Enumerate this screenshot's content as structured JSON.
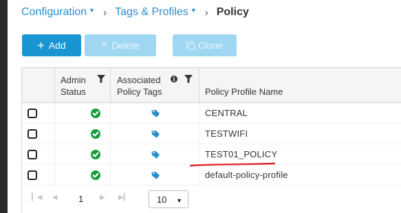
{
  "breadcrumb": {
    "items": [
      {
        "label": "Configuration"
      },
      {
        "label": "Tags & Profiles"
      }
    ],
    "current": "Policy"
  },
  "toolbar": {
    "add_label": "Add",
    "delete_label": "Delete",
    "clone_label": "Clone"
  },
  "table": {
    "columns": {
      "admin_status_line1": "Admin",
      "admin_status_line2": "Status",
      "policy_tags_line1": "Associated",
      "policy_tags_line2": "Policy Tags",
      "profile_name": "Policy Profile Name"
    },
    "rows": [
      {
        "name": "CENTRAL",
        "admin_status": "enabled"
      },
      {
        "name": "TESTWIFI",
        "admin_status": "enabled"
      },
      {
        "name": "TEST01_POLICY",
        "admin_status": "enabled"
      },
      {
        "name": "default-policy-profile",
        "admin_status": "enabled"
      }
    ]
  },
  "pager": {
    "current_page": "1",
    "per_page": "10"
  },
  "colors": {
    "primary": "#1a95d4",
    "disabled": "#9fd6f2",
    "status_ok": "#189e3d",
    "tag": "#2a8fc8",
    "annotation": "#e0262b"
  }
}
